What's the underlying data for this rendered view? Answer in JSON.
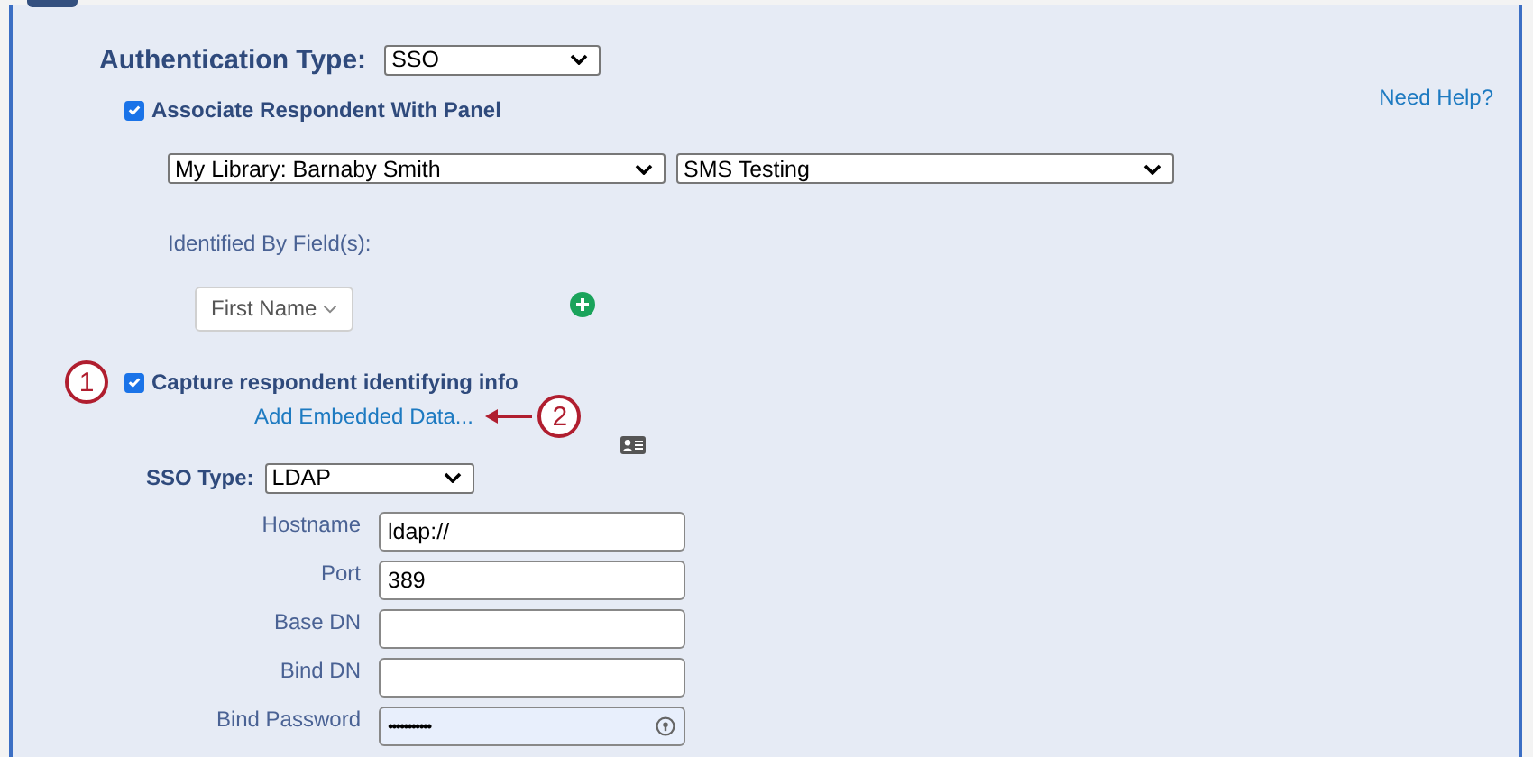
{
  "auth_type": {
    "label": "Authentication Type:",
    "value": "SSO"
  },
  "associate_panel": {
    "label": "Associate Respondent With Panel",
    "checked": true
  },
  "help_link": "Need Help?",
  "panel_selects": [
    "My Library: Barnaby Smith",
    "SMS Testing"
  ],
  "identified_by": {
    "label": "Identified By Field(s):",
    "field": "First Name"
  },
  "capture_info": {
    "label": "Capture respondent identifying info",
    "checked": true
  },
  "embedded_data_link": "Add Embedded Data...",
  "sso_type": {
    "label": "SSO Type:",
    "value": "LDAP"
  },
  "fields": [
    {
      "label": "Hostname",
      "value": "ldap://",
      "kind": "text"
    },
    {
      "label": "Port",
      "value": "389",
      "kind": "text"
    },
    {
      "label": "Base DN",
      "kind": "text"
    },
    {
      "label": "Bind DN",
      "kind": "text"
    },
    {
      "label": "Bind Password",
      "value": "•••••••••••",
      "kind": "password"
    }
  ],
  "callouts": [
    {
      "number": "1"
    },
    {
      "number": "2"
    }
  ]
}
